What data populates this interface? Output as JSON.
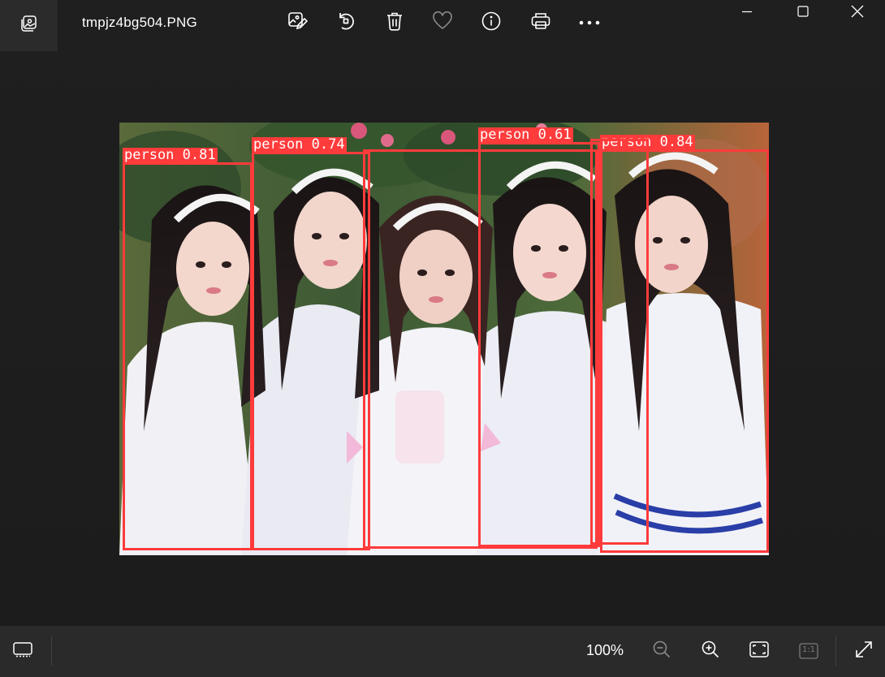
{
  "window": {
    "filename": "tmpjz4bg504.PNG"
  },
  "toolbar": {
    "items": [
      {
        "icon": "edit-image-icon"
      },
      {
        "icon": "rotate-icon"
      },
      {
        "icon": "delete-icon"
      },
      {
        "icon": "favorite-icon"
      },
      {
        "icon": "info-icon"
      },
      {
        "icon": "print-icon"
      },
      {
        "icon": "more-icon"
      }
    ]
  },
  "window_controls": [
    "minimize",
    "maximize",
    "close"
  ],
  "image": {
    "description_icon": "photo",
    "detections": [
      {
        "label": "person 0.81",
        "class": "person",
        "score": 0.81
      },
      {
        "label": "person 0.74",
        "class": "person",
        "score": 0.74
      },
      {
        "label": "person 0.61",
        "class": "person",
        "score": 0.61
      },
      {
        "label": "person 0.84",
        "class": "person",
        "score": 0.84
      }
    ],
    "box_color": "#ff3b3b"
  },
  "bottombar": {
    "zoom_level": "100%",
    "ratio_label": "1:1"
  }
}
